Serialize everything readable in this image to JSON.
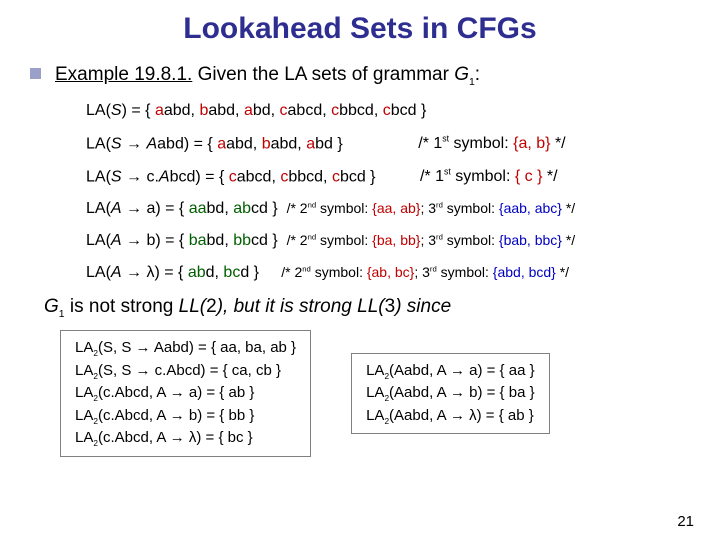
{
  "title": "Lookahead Sets in CFGs",
  "example_label": "Example 19.8.1.",
  "example_rest": " Given the LA sets of grammar ",
  "grammar": "G",
  "grammar_sub": "1",
  "la_lines": {
    "l1": "LA(S) = { aabd, babd, abd, cabcd, cbbcd, cbcd }",
    "l2a": "LA(S → Aabd) = { ",
    "l2red": "aabd, babd, abd",
    "l2b": " }",
    "l2c": "/* 1st symbol: {a, b} */",
    "l3a": "LA(S → c.Abcd) = { ",
    "l3red": "cabcd, cbbcd, cbcd",
    "l3b": " }",
    "l3c": "/* 1st symbol: { c } */",
    "l4a": "LA(A → a) = { ",
    "l4grn": "aabd, abcd",
    "l4b": " }  ",
    "l4c": "/* 2nd symbol: {aa, ab}; 3rd symbol: {aab, abc} */",
    "l5a": "LA(A → b) = { ",
    "l5grn": "babd, bbcd",
    "l5b": " }  ",
    "l5c": "/* 2nd symbol: {ba, bb}; 3rd symbol: {bab, bbc} */",
    "l6a": "LA(A → λ) = { ",
    "l6grn": "abd, bcd",
    "l6b": " }    ",
    "l6c": "/* 2nd symbol: {ab, bc}; 3rd symbol: {abd, bcd} */"
  },
  "conclusion_a": "G",
  "conclusion_b": " is not strong ",
  "conclusion_c": "LL(",
  "conclusion_d": "2",
  "conclusion_e": "), but it is strong ",
  "conclusion_f": "LL(",
  "conclusion_g": "3",
  "conclusion_h": ") since",
  "box1": {
    "r1": "LA₂(S, S → Aabd) = { aa, ba, ab }",
    "r2": "LA₂(S, S → c.Abcd) = { ca, cb }",
    "r3": "LA₂(c.Abcd, A → a) = { ab }",
    "r4": "LA₂(c.Abcd, A → b) = { bb }",
    "r5": "LA₂(c.Abcd, A → λ) = { bc }"
  },
  "box2": {
    "r1": "LA₂(Aabd, A → a) = { aa }",
    "r2": "LA₂(Aabd, A → b) = { ba }",
    "r3": "LA₂(Aabd, A → λ) = { ab }"
  },
  "page_num": "21"
}
